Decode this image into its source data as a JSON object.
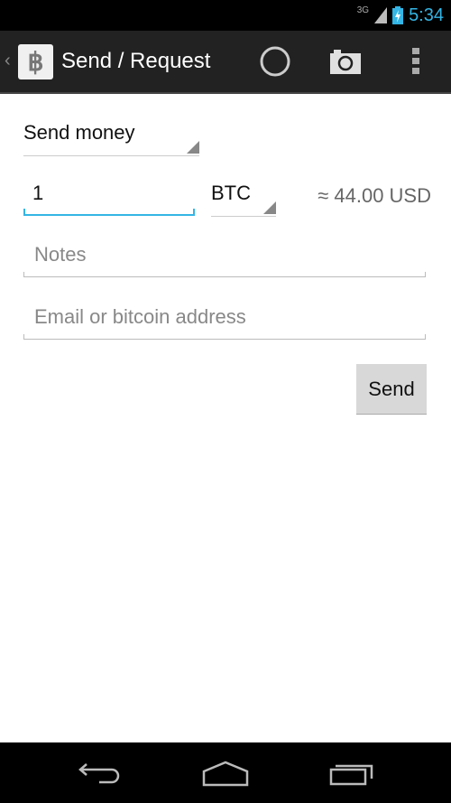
{
  "status_bar": {
    "network": "3G",
    "time": "5:34"
  },
  "action_bar": {
    "title": "Send / Request",
    "app_icon_glyph": "฿",
    "up_glyph": "‹"
  },
  "form": {
    "mode_spinner": "Send money",
    "amount_value": "1",
    "currency_spinner": "BTC",
    "conversion": "≈ 44.00 USD",
    "notes_placeholder": "Notes",
    "recipient_placeholder": "Email or bitcoin address",
    "send_label": "Send"
  },
  "colors": {
    "accent": "#33b5e5",
    "action_bar": "#222222"
  }
}
